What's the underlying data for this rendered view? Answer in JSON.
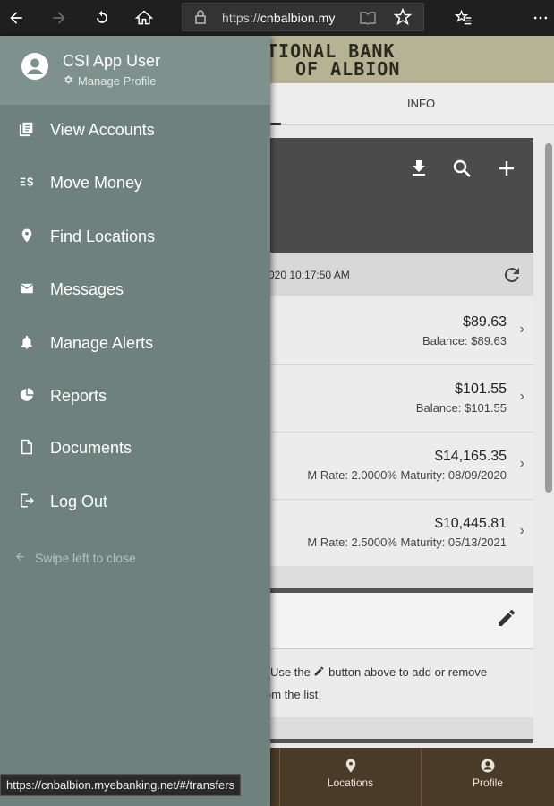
{
  "browser": {
    "url_scheme": "https://",
    "url_host": "cnbalbion.my",
    "status_url": "https://cnbalbion.myebanking.net/#/transfers"
  },
  "bank": {
    "name_line1": "TIONAL BANK",
    "name_line2": "OF ALBION"
  },
  "tabs": {
    "info_label": "INFO"
  },
  "accounts": {
    "updated_text": "020 10:17:50 AM",
    "rows": [
      {
        "amount": "$89.63",
        "detail": "Balance: $89.63"
      },
      {
        "amount": "$101.55",
        "detail": "Balance: $101.55"
      },
      {
        "amount": "$14,165.35",
        "detail": "M  Rate: 2.0000%  Maturity: 08/09/2020"
      },
      {
        "amount": "$10,445.81",
        "detail": "M  Rate: 2.5000%  Maturity: 05/13/2021"
      }
    ]
  },
  "shortcuts": {
    "hint_line1": "Use the",
    "hint_line1b": "button above to add or remove",
    "hint_line2": "om the list"
  },
  "bottom_nav": {
    "locations": "Locations",
    "profile": "Profile"
  },
  "drawer": {
    "user_name": "CSI App User",
    "manage_profile": "Manage Profile",
    "items": [
      {
        "label": "View Accounts",
        "icon": "accounts-icon"
      },
      {
        "label": "Move Money",
        "icon": "transfer-icon"
      },
      {
        "label": "Find Locations",
        "icon": "location-pin-icon"
      },
      {
        "label": "Messages",
        "icon": "mail-icon"
      },
      {
        "label": "Manage Alerts",
        "icon": "bell-icon"
      },
      {
        "label": "Reports",
        "icon": "pie-chart-icon"
      },
      {
        "label": "Documents",
        "icon": "document-icon"
      },
      {
        "label": "Log Out",
        "icon": "logout-icon"
      }
    ],
    "swipe_hint": "Swipe left to close"
  },
  "colors": {
    "drawer_bg": "#6f817c",
    "drawer_header": "#7f918c",
    "bottom_nav": "#4a3b28",
    "banner": "#b6b394"
  }
}
